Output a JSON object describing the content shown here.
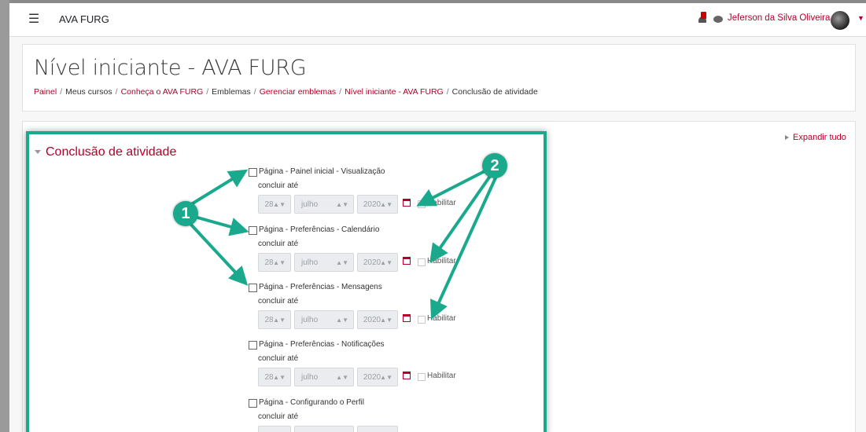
{
  "navbar": {
    "brand": "AVA FURG",
    "user_name": "Jeferson da Silva Oliveira"
  },
  "page": {
    "title": "Nível iniciante - AVA FURG"
  },
  "breadcrumb": [
    {
      "label": "Painel",
      "link": true
    },
    {
      "label": "Meus cursos",
      "link": false
    },
    {
      "label": "Conheça o AVA FURG",
      "link": true
    },
    {
      "label": "Emblemas",
      "link": false
    },
    {
      "label": "Gerenciar emblemas",
      "link": true
    },
    {
      "label": "Nível iniciante - AVA FURG",
      "link": true
    },
    {
      "label": "Conclusão de atividade",
      "link": false
    }
  ],
  "expand_all": "Expandir tudo",
  "section": {
    "title": "Conclusão de atividade"
  },
  "activities": [
    {
      "label": "Página - Painel inicial - Visualização",
      "until": "concluir até",
      "day": "28",
      "month": "julho",
      "year": "2020",
      "enable": "Habilitar"
    },
    {
      "label": "Página - Preferências - Calendário",
      "until": "concluir até",
      "day": "28",
      "month": "julho",
      "year": "2020",
      "enable": "Habilitar"
    },
    {
      "label": "Página - Preferências - Mensagens",
      "until": "concluir até",
      "day": "28",
      "month": "julho",
      "year": "2020",
      "enable": "Habilitar"
    },
    {
      "label": "Página - Preferências - Notificações",
      "until": "concluir até",
      "day": "28",
      "month": "julho",
      "year": "2020",
      "enable": "Habilitar"
    },
    {
      "label": "Página - Configurando o Perfil",
      "until": "concluir até",
      "day": "",
      "month": "",
      "year": "",
      "enable": ""
    }
  ],
  "annotations": {
    "marker_1": "1",
    "marker_2": "2",
    "color": "#1aa98c"
  },
  "colors": {
    "accent": "#b3002a",
    "highlight": "#1aa98c"
  }
}
